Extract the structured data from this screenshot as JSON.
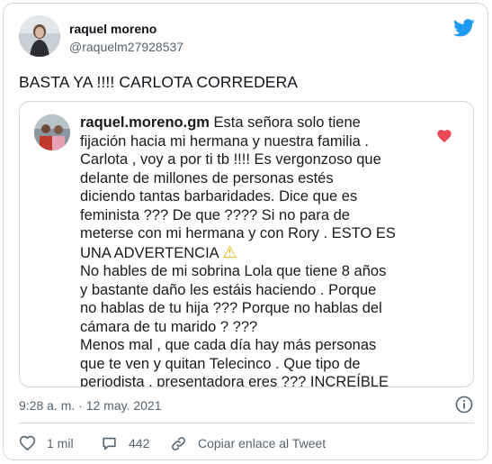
{
  "author": {
    "name": "raquel moreno",
    "handle": "@raquelm27928537"
  },
  "tweet": {
    "text": "BASTA YA !!!! CARLOTA CORREDERA",
    "timestamp": "9:28 a. m. · 12 may. 2021"
  },
  "embedded_post": {
    "username": "raquel.moreno.gm",
    "paragraph1_lines": [
      "fijación hacia mi hermana y nuestra familia .",
      "Carlota , voy a por ti tb !!!! Es vergonzoso que",
      "delante de millones de personas estés",
      "diciendo tantas barbaridades. Dice que es",
      "feminista ??? De que ???? Si no para de",
      "meterse con mi hermana y con Rory .  ESTO ES"
    ],
    "first_line_rest": " Esta señora solo tiene",
    "advertencia": "UNA ADVERTENCIA",
    "warning_emoji": "⚠",
    "paragraph2_lines": [
      "No hables de mi sobrina Lola que tiene 8 años",
      "y bastante daño les estáis haciendo . Porque",
      "no hablas de tu hija ??? Porque no hablas del",
      "cámara de tu marido ? ???"
    ],
    "paragraph3_lines": [
      "Menos mal , que cada día hay más personas",
      "que te ven y quitan Telecinco .  Que tipo de",
      "periodista , presentadora eres ??? INCREÍBLE"
    ]
  },
  "actions": {
    "likes": "1 mil",
    "replies": "442",
    "copy_link": "Copiar enlace al Tweet"
  },
  "icons": {
    "brand": "twitter-bird-icon",
    "brand_color": "#1d9bf0",
    "heart_color": "#ed4956",
    "warning_color": "#f5c518"
  }
}
